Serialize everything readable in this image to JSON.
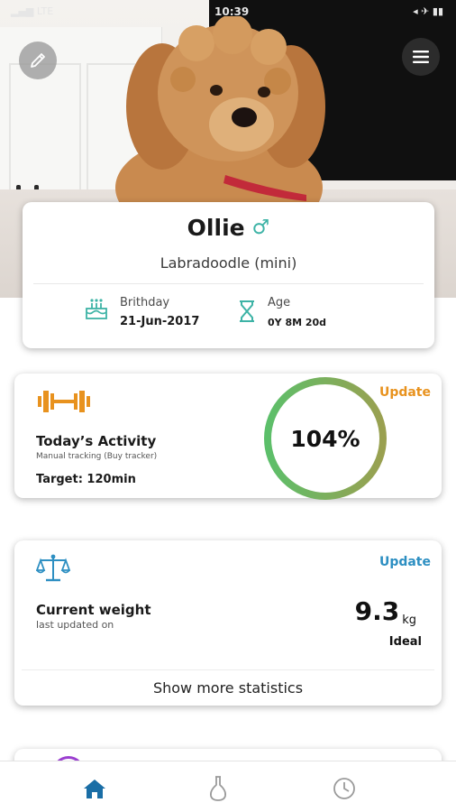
{
  "status_bar": {
    "time": "10:39",
    "left": "▂▄▆ LTE",
    "right": "◂ ✈ ▮▮"
  },
  "profile": {
    "name": "Ollie",
    "gender_symbol": "♂",
    "breed": "Labradoodle (mini)",
    "birthday_label": "Brithday",
    "birthday_value": "21-Jun-2017",
    "age_label": "Age",
    "age_value": "0Y 8M 20d"
  },
  "activity": {
    "update_label": "Update",
    "title": "Today’s Activity",
    "subtitle": "Manual tracking (Buy tracker)",
    "target": "Target: 120min",
    "percent_text": "104%",
    "percent_value": 104
  },
  "weight": {
    "update_label": "Update",
    "title": "Current weight",
    "subtitle": "last updated on",
    "value": "9.3",
    "unit": "kg",
    "status": "Ideal",
    "more_label": "Show more statistics"
  },
  "tabs": [
    {
      "icon": "home-icon",
      "active": true
    },
    {
      "icon": "flask-icon",
      "active": false
    },
    {
      "icon": "clock-icon",
      "active": false
    }
  ],
  "colors": {
    "accent_teal": "#3db3a6",
    "activity_orange": "#e8921e",
    "weight_blue": "#2d8fc2",
    "gauge_green": "#5cbf6a",
    "gauge_olive": "#9aa050",
    "tab_active": "#1a6ea6"
  }
}
